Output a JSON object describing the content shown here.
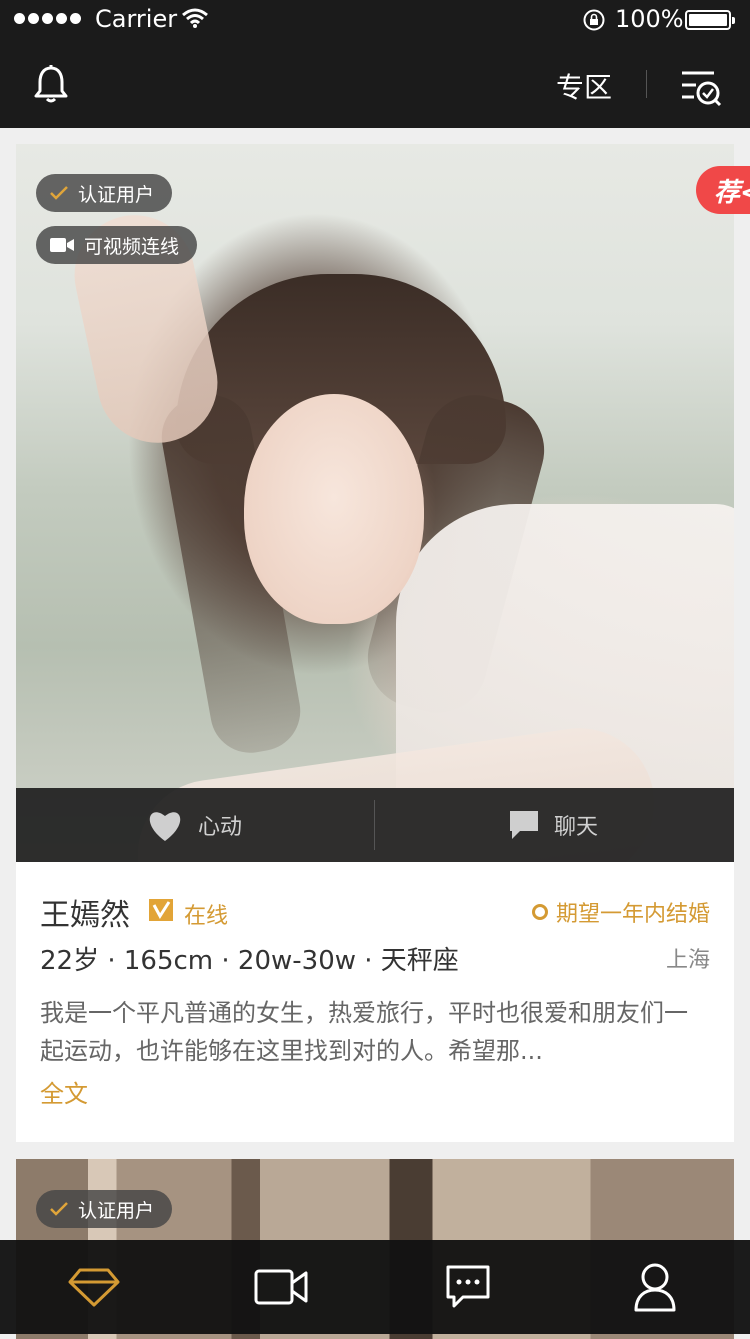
{
  "status_bar": {
    "carrier": "Carrier",
    "battery": "100%"
  },
  "nav": {
    "zone_label": "专区",
    "icons": [
      "bell-icon",
      "filter-icon"
    ]
  },
  "profile": {
    "badges": {
      "verified": "认证用户",
      "video": "可视频连线"
    },
    "recommend_tag": "荐<",
    "actions": {
      "like": "心动",
      "chat": "聊天"
    },
    "name": "王嫣然",
    "online": "在线",
    "goal": "期望一年内结婚",
    "stats": "22岁 · 165cm  · 20w-30w · 天秤座",
    "city": "上海",
    "bio": "我是一个平凡普通的女生，热爱旅行，平时也很爱和朋友们一起运动，也许能够在这里找到对的人。希望那...",
    "read_more": "全文"
  },
  "next_profile": {
    "badge": "认证用户"
  },
  "tabbar": {
    "tabs": [
      "diamond-icon",
      "video-camera-icon",
      "chat-bubble-icon",
      "user-icon"
    ],
    "active": "diamond-icon",
    "accent": "#d49a33"
  }
}
